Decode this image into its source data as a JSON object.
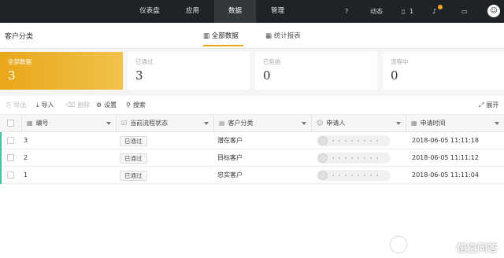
{
  "topnav": {
    "items": [
      {
        "label": "仪表盘"
      },
      {
        "label": "应用"
      },
      {
        "label": "数据"
      },
      {
        "label": "管理"
      }
    ],
    "help_icon": "?",
    "activity_label": "动态",
    "tasks_count": "1",
    "avatar_icon": "☺"
  },
  "page": {
    "title": "客户分类",
    "tabs": [
      {
        "label": "全部数据",
        "icon": "bar-chart-icon"
      },
      {
        "label": "统计报表",
        "icon": "table-icon"
      }
    ]
  },
  "stats": [
    {
      "label": "全部数据",
      "value": "3"
    },
    {
      "label": "已通过",
      "value": "3"
    },
    {
      "label": "已拒绝",
      "value": "0"
    },
    {
      "label": "流程中",
      "value": "0"
    }
  ],
  "toolbar": {
    "export": "导出",
    "import": "导入",
    "delete": "删除",
    "settings": "设置",
    "search": "搜索",
    "expand": "展开"
  },
  "table": {
    "columns": [
      "编号",
      "当前流程状态",
      "客户分类",
      "申请人",
      "申请时间"
    ],
    "rows": [
      {
        "id": "3",
        "status": "已通过",
        "category": "潜在客户",
        "time": "2018-06-05 11:11:18"
      },
      {
        "id": "2",
        "status": "已通过",
        "category": "目标客户",
        "time": "2018-06-05 11:11:12"
      },
      {
        "id": "1",
        "status": "已通过",
        "category": "忠实客户",
        "time": "2018-06-05 11:11:04"
      }
    ]
  },
  "watermark": "悟空问答",
  "colors": {
    "accent": "#e9a71a",
    "topbar": "#1f2327",
    "row_marker": "#3cc6a0"
  }
}
